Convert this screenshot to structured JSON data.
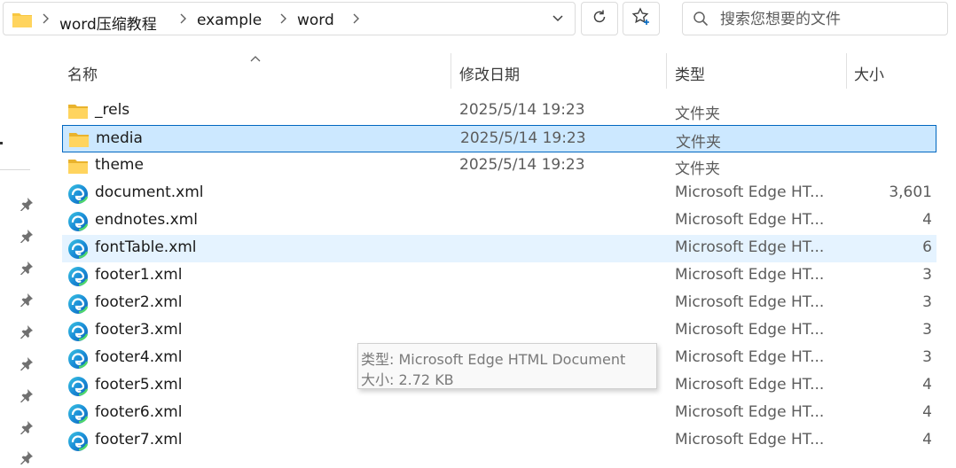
{
  "address": {
    "breadcrumbs": [
      "word压缩教程",
      "example",
      "word"
    ]
  },
  "search": {
    "placeholder": "搜索您想要的文件"
  },
  "columns": {
    "name": "名称",
    "date": "修改日期",
    "type": "类型",
    "size": "大小"
  },
  "rows": [
    {
      "name": "_rels",
      "date": "2025/5/14 19:23",
      "type": "文件夹",
      "size": "",
      "icon": "folder-icon"
    },
    {
      "name": "media",
      "date": "2025/5/14 19:23",
      "type": "文件夹",
      "size": "",
      "icon": "folder-icon",
      "selected": true
    },
    {
      "name": "theme",
      "date": "2025/5/14 19:23",
      "type": "文件夹",
      "size": "",
      "icon": "folder-icon"
    },
    {
      "name": "document.xml",
      "date": "",
      "type": "Microsoft Edge HT...",
      "size": "3,601",
      "icon": "edge-icon"
    },
    {
      "name": "endnotes.xml",
      "date": "",
      "type": "Microsoft Edge HT...",
      "size": "4",
      "icon": "edge-icon"
    },
    {
      "name": "fontTable.xml",
      "date": "",
      "type": "Microsoft Edge HT...",
      "size": "6",
      "icon": "edge-icon",
      "hovered": true
    },
    {
      "name": "footer1.xml",
      "date": "",
      "type": "Microsoft Edge HT...",
      "size": "3",
      "icon": "edge-icon"
    },
    {
      "name": "footer2.xml",
      "date": "",
      "type": "Microsoft Edge HT...",
      "size": "3",
      "icon": "edge-icon"
    },
    {
      "name": "footer3.xml",
      "date": "",
      "type": "Microsoft Edge HT...",
      "size": "3",
      "icon": "edge-icon"
    },
    {
      "name": "footer4.xml",
      "date": "",
      "type": "Microsoft Edge HT...",
      "size": "3",
      "icon": "edge-icon"
    },
    {
      "name": "footer5.xml",
      "date": "",
      "type": "Microsoft Edge HT...",
      "size": "4",
      "icon": "edge-icon"
    },
    {
      "name": "footer6.xml",
      "date": "",
      "type": "Microsoft Edge HT...",
      "size": "4",
      "icon": "edge-icon"
    },
    {
      "name": "footer7.xml",
      "date": "",
      "type": "Microsoft Edge HT...",
      "size": "4",
      "icon": "edge-icon"
    }
  ],
  "tooltip": {
    "type_line": "类型: Microsoft Edge HTML Document",
    "size_line": "大小: 2.72 KB"
  },
  "colors": {
    "selected_bg": "#cce8ff",
    "selected_border": "#0067c0",
    "hover_bg": "#e5f3ff",
    "folder": "#f8c741"
  }
}
